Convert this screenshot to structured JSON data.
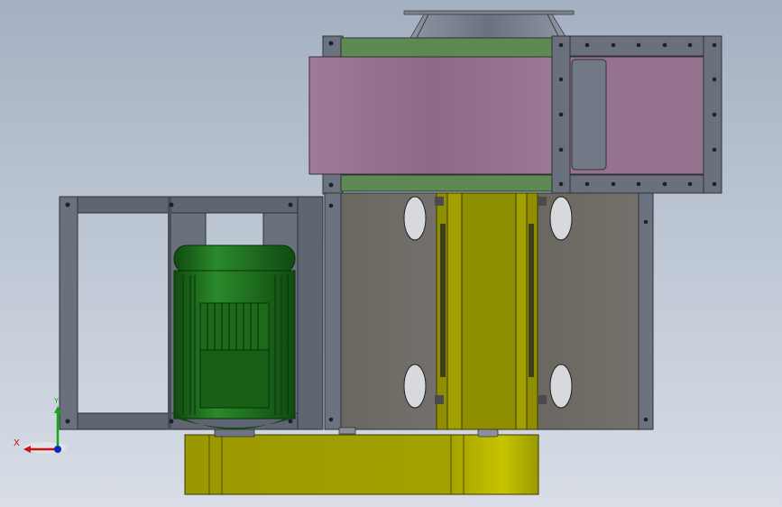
{
  "colors": {
    "frame": "#5d6470",
    "frame_light": "#8b919c",
    "motor_green": "#1e6e1e",
    "motor_dark": "#0f4510",
    "housing_pink": "#9a7593",
    "housing_gray": "#6e6c68",
    "base_yellow": "#a5a300",
    "axis_x": "#cc1111",
    "axis_y": "#11aa11",
    "axis_z": "#1122cc"
  },
  "triad": {
    "x_label": "X",
    "y_label": "Y"
  }
}
